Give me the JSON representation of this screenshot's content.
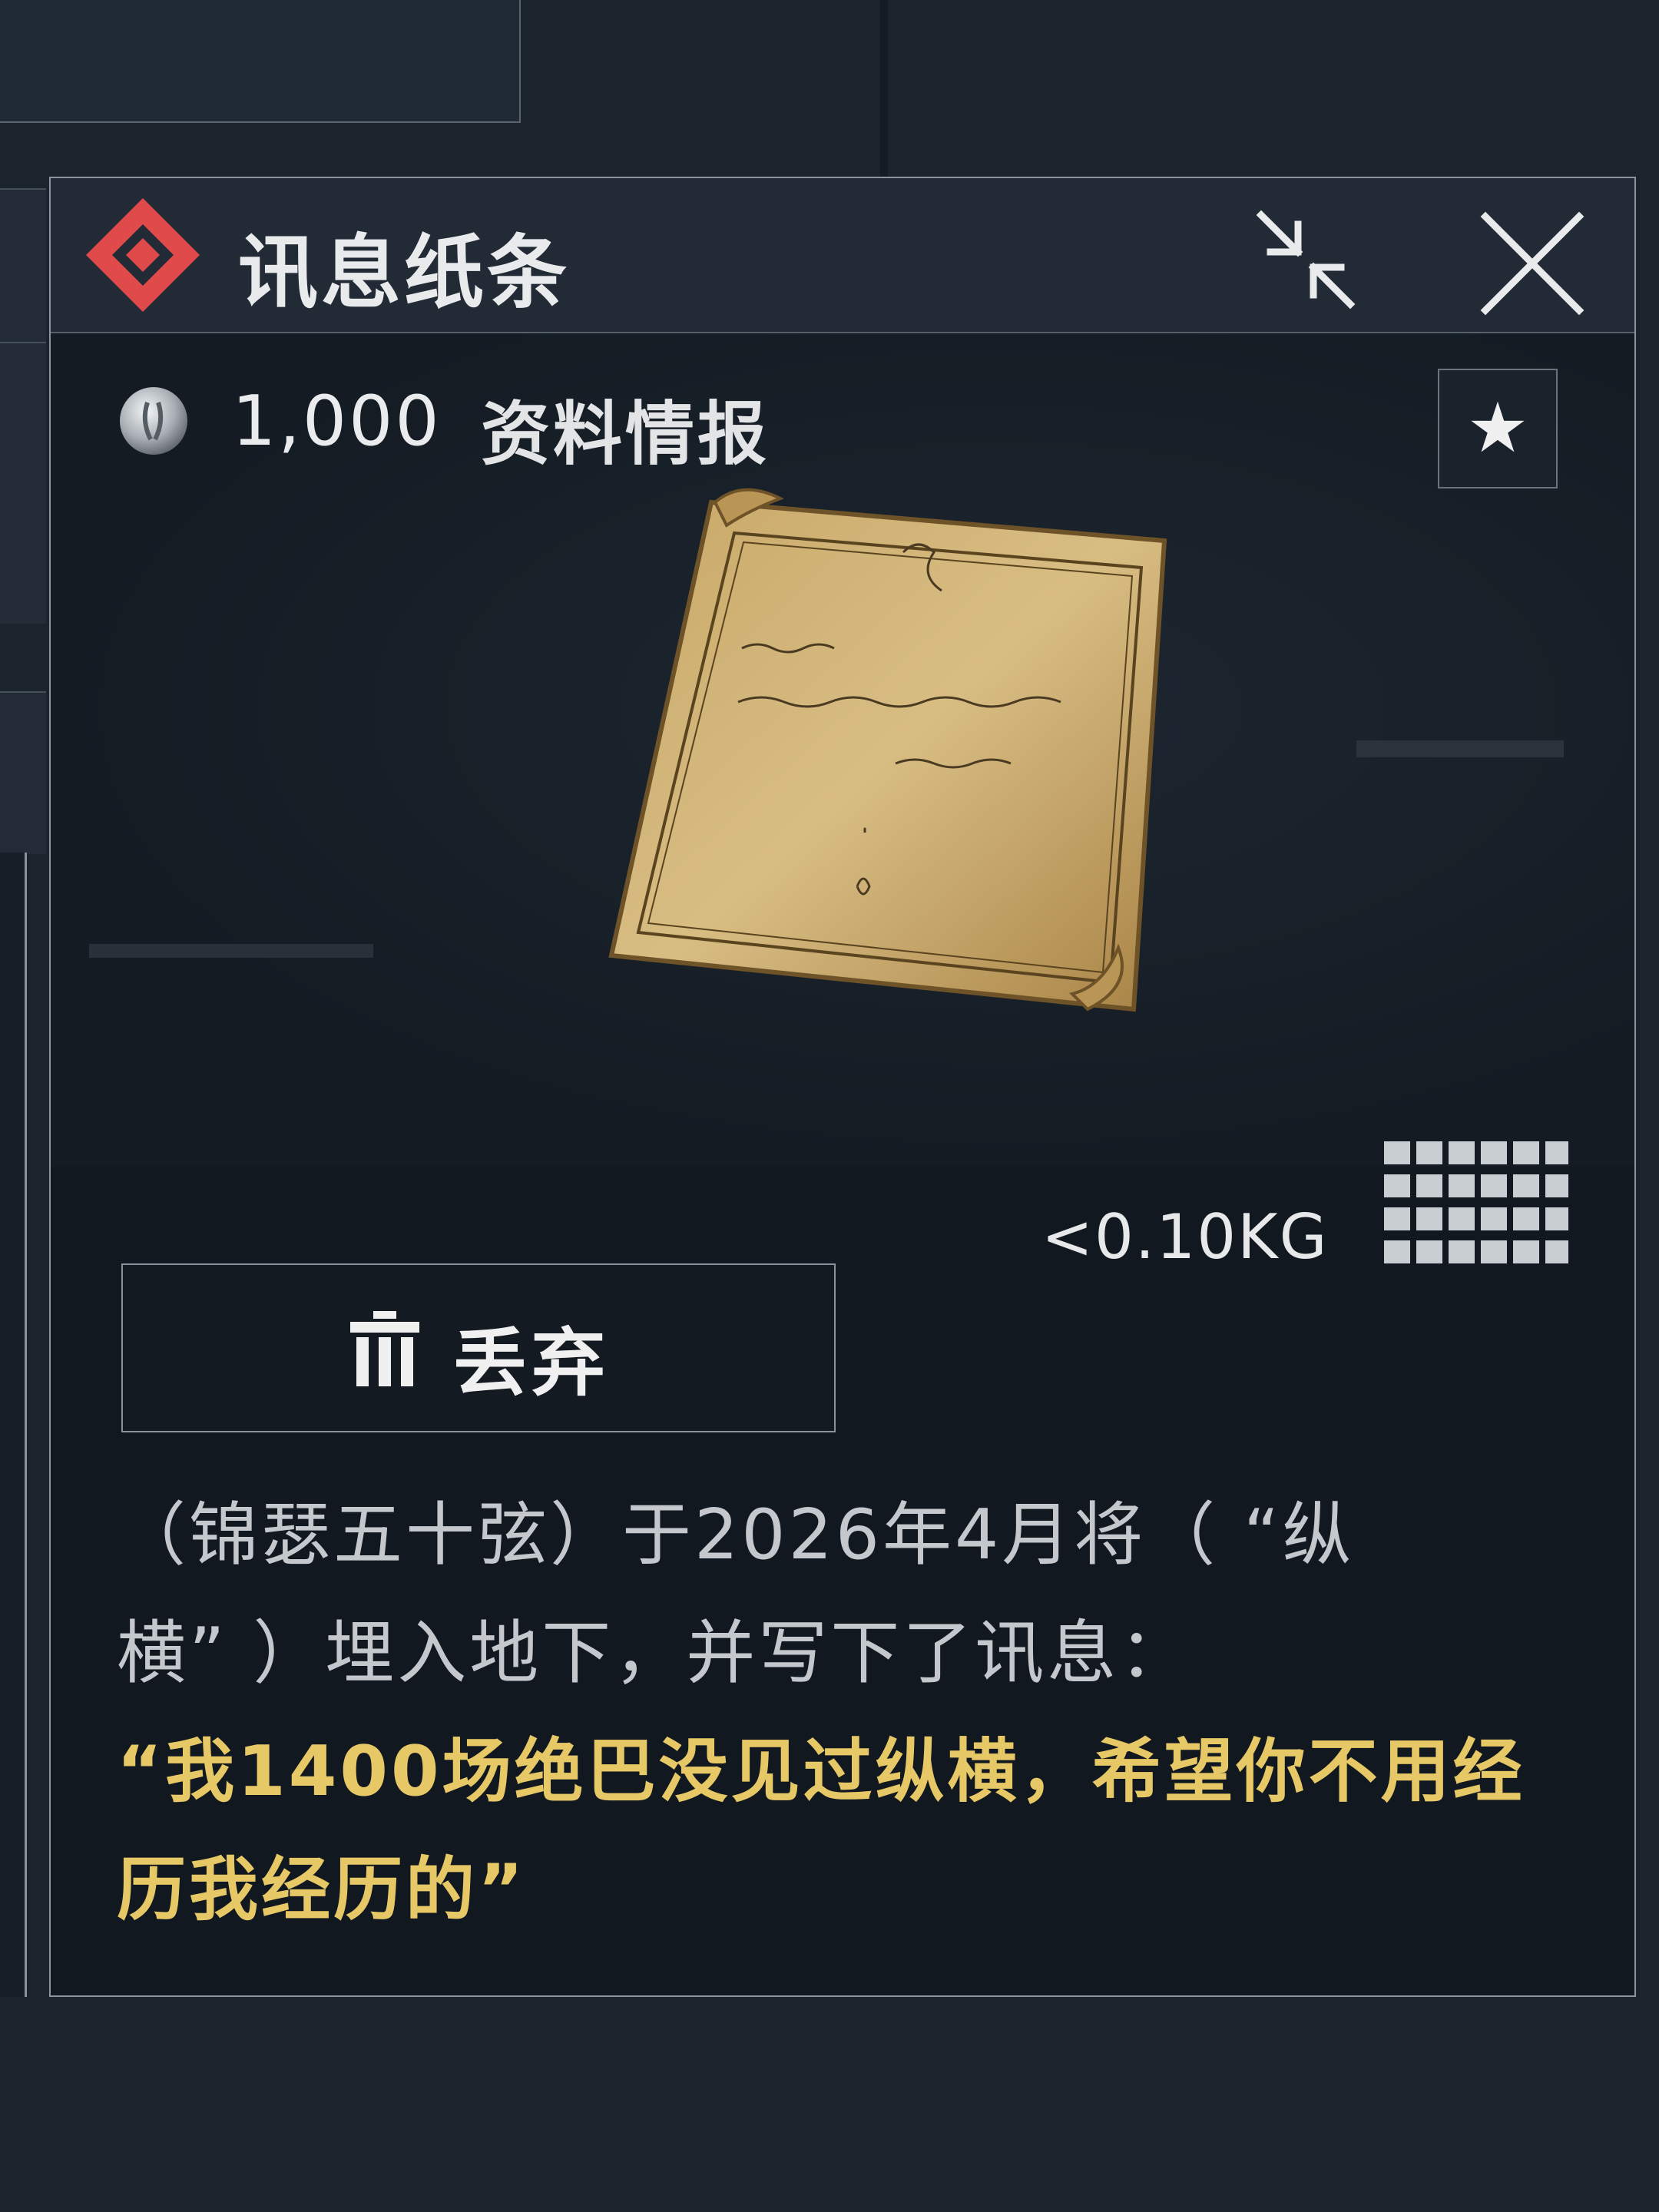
{
  "dialog": {
    "title": "讯息纸条",
    "title_icon": "red-diamond-icon",
    "shrink_icon": "collapse-arrows-icon",
    "close_icon": "close-x-icon"
  },
  "item": {
    "price": "1,000",
    "category": "资料情报",
    "favorite_icon": "★",
    "weight": "<0.10KG",
    "size_icon": "grid-size-icon"
  },
  "actions": {
    "discard_label": "丢弃",
    "discard_icon": "trash-icon"
  },
  "description": {
    "line1": "（锦瑟五十弦）于2026年4月将（ “纵",
    "line2": "横” ）埋入地下，并写下了讯息：",
    "quote_line1": "“我1400场绝巴没见过纵横，希望你不用经",
    "quote_line2": "历我经历的”"
  },
  "colors": {
    "accent_red": "#e04a4a",
    "quote_gold": "#e7c866",
    "panel_bg": "#121820"
  }
}
